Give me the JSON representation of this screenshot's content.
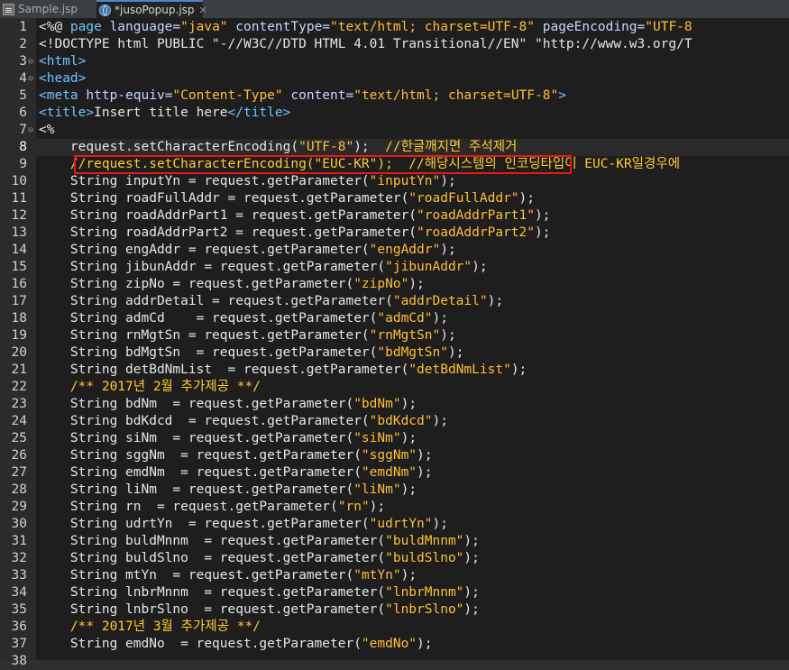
{
  "tabs": [
    {
      "label": "Sample.jsp",
      "icon": "jsp-file-icon",
      "active": false
    },
    {
      "label": "*jusoPopup.jsp",
      "icon": "jsp-globe-icon",
      "active": true
    }
  ],
  "tab_close": "✕",
  "fold_marker": "⊖",
  "lines": [
    {
      "n": "1",
      "tokens": [
        [
          "text",
          "<%@ "
        ],
        [
          "kw",
          "page "
        ],
        [
          "attr",
          "language="
        ],
        [
          "str",
          "\"java\""
        ],
        [
          "attr",
          " contentType="
        ],
        [
          "str",
          "\"text/html; charset=UTF-8\""
        ],
        [
          "attr",
          " pageEncoding="
        ],
        [
          "str",
          "\"UTF-8"
        ]
      ]
    },
    {
      "n": "2",
      "tokens": [
        [
          "text",
          "<!DOCTYPE html PUBLIC \"-//W3C//DTD HTML 4.01 Transitional//EN\" \"http://www.w3.org/T"
        ]
      ]
    },
    {
      "n": "3",
      "fold": true,
      "tokens": [
        [
          "tag",
          "<html>"
        ]
      ]
    },
    {
      "n": "4",
      "fold": true,
      "tokens": [
        [
          "tag",
          "<head>"
        ]
      ]
    },
    {
      "n": "5",
      "tokens": [
        [
          "tag",
          "<meta "
        ],
        [
          "attr",
          "http-equiv="
        ],
        [
          "str",
          "\"Content-Type\""
        ],
        [
          "attr",
          " content="
        ],
        [
          "str",
          "\"text/html; charset=UTF-8\""
        ],
        [
          "tag",
          ">"
        ]
      ]
    },
    {
      "n": "6",
      "tokens": [
        [
          "tag",
          "<title>"
        ],
        [
          "text",
          "Insert title here"
        ],
        [
          "tag",
          "</title>"
        ]
      ]
    },
    {
      "n": "7",
      "fold": true,
      "tokens": [
        [
          "text",
          "<%"
        ]
      ]
    },
    {
      "n": "8",
      "cur": true,
      "tokens": [
        [
          "text",
          "    request.setCharacterEncoding("
        ],
        [
          "str",
          "\"UTF-8\""
        ],
        [
          "text",
          ");  "
        ],
        [
          "cmt",
          "//한글깨지면 주석제거"
        ]
      ]
    },
    {
      "n": "9",
      "tokens": [
        [
          "cmt",
          "    //request.setCharacterEncoding(\"EUC-KR\");  //해당시스템의 인코딩타입이 EUC-KR일경우에"
        ]
      ]
    },
    {
      "n": "10",
      "tokens": [
        [
          "text",
          "    String inputYn = request.getParameter("
        ],
        [
          "str",
          "\"inputYn\""
        ],
        [
          "text",
          ");"
        ]
      ]
    },
    {
      "n": "11",
      "tokens": [
        [
          "text",
          "    String roadFullAddr = request.getParameter("
        ],
        [
          "str",
          "\"roadFullAddr\""
        ],
        [
          "text",
          ");"
        ]
      ]
    },
    {
      "n": "12",
      "tokens": [
        [
          "text",
          "    String roadAddrPart1 = request.getParameter("
        ],
        [
          "str",
          "\"roadAddrPart1\""
        ],
        [
          "text",
          ");"
        ]
      ]
    },
    {
      "n": "13",
      "tokens": [
        [
          "text",
          "    String roadAddrPart2 = request.getParameter("
        ],
        [
          "str",
          "\"roadAddrPart2\""
        ],
        [
          "text",
          ");"
        ]
      ]
    },
    {
      "n": "14",
      "tokens": [
        [
          "text",
          "    String engAddr = request.getParameter("
        ],
        [
          "str",
          "\"engAddr\""
        ],
        [
          "text",
          ");"
        ]
      ]
    },
    {
      "n": "15",
      "tokens": [
        [
          "text",
          "    String jibunAddr = request.getParameter("
        ],
        [
          "str",
          "\"jibunAddr\""
        ],
        [
          "text",
          ");"
        ]
      ]
    },
    {
      "n": "16",
      "tokens": [
        [
          "text",
          "    String zipNo = request.getParameter("
        ],
        [
          "str",
          "\"zipNo\""
        ],
        [
          "text",
          ");"
        ]
      ]
    },
    {
      "n": "17",
      "tokens": [
        [
          "text",
          "    String addrDetail = request.getParameter("
        ],
        [
          "str",
          "\"addrDetail\""
        ],
        [
          "text",
          ");"
        ]
      ]
    },
    {
      "n": "18",
      "tokens": [
        [
          "text",
          "    String admCd    = request.getParameter("
        ],
        [
          "str",
          "\"admCd\""
        ],
        [
          "text",
          ");"
        ]
      ]
    },
    {
      "n": "19",
      "tokens": [
        [
          "text",
          "    String rnMgtSn = request.getParameter("
        ],
        [
          "str",
          "\"rnMgtSn\""
        ],
        [
          "text",
          ");"
        ]
      ]
    },
    {
      "n": "20",
      "tokens": [
        [
          "text",
          "    String bdMgtSn  = request.getParameter("
        ],
        [
          "str",
          "\"bdMgtSn\""
        ],
        [
          "text",
          ");"
        ]
      ]
    },
    {
      "n": "21",
      "tokens": [
        [
          "text",
          "    String detBdNmList  = request.getParameter("
        ],
        [
          "str",
          "\"detBdNmList\""
        ],
        [
          "text",
          ");"
        ]
      ]
    },
    {
      "n": "22",
      "tokens": [
        [
          "jcmt",
          "    /** 2017년 2월 추가제공 **/"
        ]
      ]
    },
    {
      "n": "23",
      "tokens": [
        [
          "text",
          "    String bdNm  = request.getParameter("
        ],
        [
          "str",
          "\"bdNm\""
        ],
        [
          "text",
          ");"
        ]
      ]
    },
    {
      "n": "24",
      "tokens": [
        [
          "text",
          "    String bdKdcd  = request.getParameter("
        ],
        [
          "str",
          "\"bdKdcd\""
        ],
        [
          "text",
          ");"
        ]
      ]
    },
    {
      "n": "25",
      "tokens": [
        [
          "text",
          "    String siNm  = request.getParameter("
        ],
        [
          "str",
          "\"siNm\""
        ],
        [
          "text",
          ");"
        ]
      ]
    },
    {
      "n": "26",
      "tokens": [
        [
          "text",
          "    String sggNm  = request.getParameter("
        ],
        [
          "str",
          "\"sggNm\""
        ],
        [
          "text",
          ");"
        ]
      ]
    },
    {
      "n": "27",
      "tokens": [
        [
          "text",
          "    String emdNm  = request.getParameter("
        ],
        [
          "str",
          "\"emdNm\""
        ],
        [
          "text",
          ");"
        ]
      ]
    },
    {
      "n": "28",
      "tokens": [
        [
          "text",
          "    String liNm  = request.getParameter("
        ],
        [
          "str",
          "\"liNm\""
        ],
        [
          "text",
          ");"
        ]
      ]
    },
    {
      "n": "29",
      "tokens": [
        [
          "text",
          "    String rn  = request.getParameter("
        ],
        [
          "str",
          "\"rn\""
        ],
        [
          "text",
          ");"
        ]
      ]
    },
    {
      "n": "30",
      "tokens": [
        [
          "text",
          "    String udrtYn  = request.getParameter("
        ],
        [
          "str",
          "\"udrtYn\""
        ],
        [
          "text",
          ");"
        ]
      ]
    },
    {
      "n": "31",
      "tokens": [
        [
          "text",
          "    String buldMnnm  = request.getParameter("
        ],
        [
          "str",
          "\"buldMnnm\""
        ],
        [
          "text",
          ");"
        ]
      ]
    },
    {
      "n": "32",
      "tokens": [
        [
          "text",
          "    String buldSlno  = request.getParameter("
        ],
        [
          "str",
          "\"buldSlno\""
        ],
        [
          "text",
          ");"
        ]
      ]
    },
    {
      "n": "33",
      "tokens": [
        [
          "text",
          "    String mtYn  = request.getParameter("
        ],
        [
          "str",
          "\"mtYn\""
        ],
        [
          "text",
          ");"
        ]
      ]
    },
    {
      "n": "34",
      "tokens": [
        [
          "text",
          "    String lnbrMnnm  = request.getParameter("
        ],
        [
          "str",
          "\"lnbrMnnm\""
        ],
        [
          "text",
          ");"
        ]
      ]
    },
    {
      "n": "35",
      "tokens": [
        [
          "text",
          "    String lnbrSlno  = request.getParameter("
        ],
        [
          "str",
          "\"lnbrSlno\""
        ],
        [
          "text",
          ");"
        ]
      ]
    },
    {
      "n": "36",
      "tokens": [
        [
          "jcmt",
          "    /** 2017년 3월 추가제공 **/"
        ]
      ]
    },
    {
      "n": "37",
      "tokens": [
        [
          "text",
          "    String emdNo  = request.getParameter("
        ],
        [
          "str",
          "\"emdNo\""
        ],
        [
          "text",
          ");"
        ]
      ]
    },
    {
      "n": "38",
      "tokens": []
    }
  ],
  "colors": {
    "editor_bg": "#1e1e1e",
    "string": "#ffbf3a",
    "tag": "#6ec6ff",
    "comment": "#ffcc33",
    "highlight_border": "#e81818"
  }
}
